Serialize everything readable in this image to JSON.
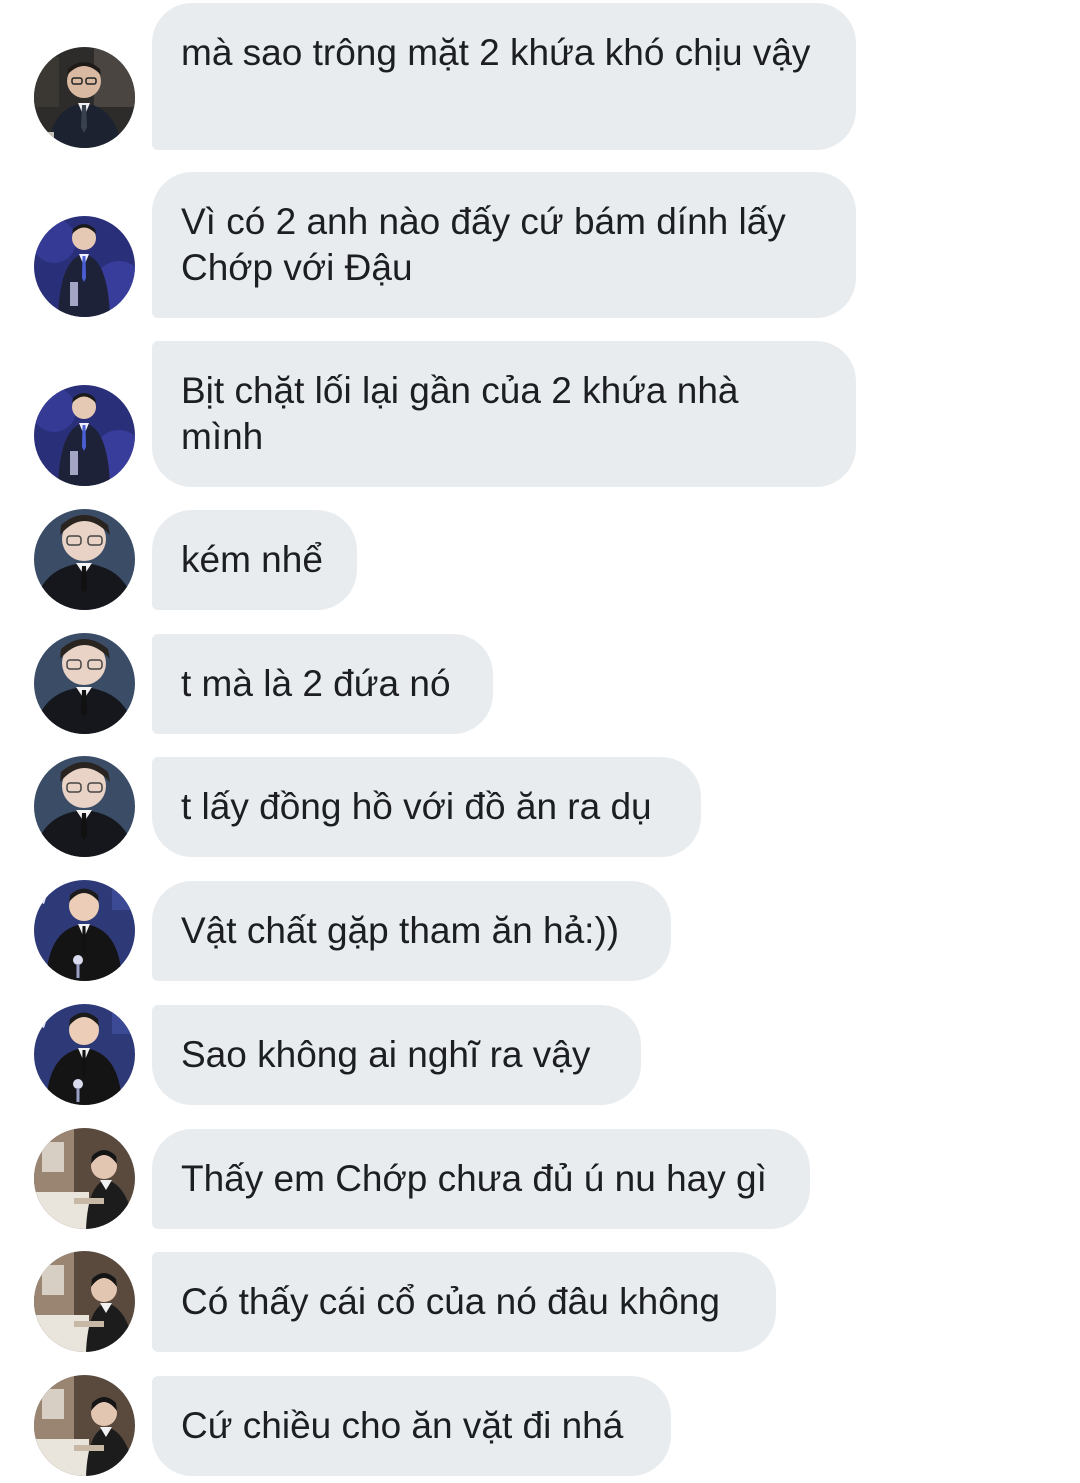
{
  "conversation": {
    "messages": [
      {
        "text": "mà sao trông mặt 2 khứa khó chịu vậy",
        "avatar": "avatar-a"
      },
      {
        "text": "Vì có 2 anh nào đấy cứ bám dính lấy Chớp với Đậu",
        "avatar": "avatar-b"
      },
      {
        "text": "Bịt chặt lối lại gần của 2 khứa nhà mình",
        "avatar": "avatar-b"
      },
      {
        "text": "kém nhể",
        "avatar": "avatar-c"
      },
      {
        "text": "t mà là 2 đứa nó",
        "avatar": "avatar-c"
      },
      {
        "text": "t lấy đồng hồ với đồ ăn ra dụ",
        "avatar": "avatar-c"
      },
      {
        "text": "Vật chất gặp tham ăn hả:))",
        "avatar": "avatar-d"
      },
      {
        "text": "Sao không ai nghĩ ra vậy",
        "avatar": "avatar-d"
      },
      {
        "text": "Thấy em Chớp chưa đủ ú nu hay gì",
        "avatar": "avatar-e"
      },
      {
        "text": "Có thấy cái cổ của nó đâu không",
        "avatar": "avatar-e"
      },
      {
        "text": "Cứ chiều cho ăn vặt đi nhá",
        "avatar": "avatar-e"
      }
    ]
  },
  "colors": {
    "bubble_bg": "#e9ecef",
    "text": "#1c1e21",
    "background": "#ffffff"
  }
}
